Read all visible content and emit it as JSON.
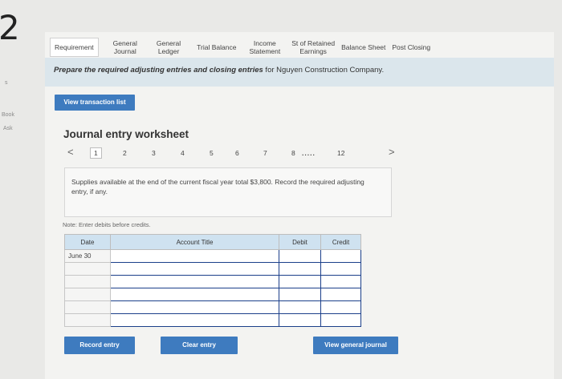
{
  "question_number": "2",
  "side_labels": {
    "mark": "s",
    "book": "Book",
    "ask": "Ask"
  },
  "tabs": [
    {
      "label": "Requirement",
      "active": true
    },
    {
      "label": "General\nJournal",
      "active": false
    },
    {
      "label": "General\nLedger",
      "active": false
    },
    {
      "label": "Trial Balance",
      "active": false
    },
    {
      "label": "Income\nStatement",
      "active": false
    },
    {
      "label": "St of Retained\nEarnings",
      "active": false
    },
    {
      "label": "Balance Sheet",
      "active": false
    },
    {
      "label": "Post Closing",
      "active": false
    }
  ],
  "prompt": {
    "bold": "Prepare the required adjusting entries and closing entries",
    "rest": " for Nguyen Construction Company."
  },
  "view_transactions_label": "View transaction list",
  "worksheet_title": "Journal entry worksheet",
  "pager": {
    "prev": "<",
    "next": ">",
    "pages": [
      "1",
      "2",
      "3",
      "4",
      "5",
      "6",
      "7",
      "8"
    ],
    "ellipsis": ".....",
    "last": "12",
    "current": "1"
  },
  "description": "Supplies available at the end of the current fiscal year total $3,800. Record the required adjusting entry, if any.",
  "note": "Note: Enter debits before credits.",
  "table": {
    "headers": [
      "Date",
      "Account Title",
      "Debit",
      "Credit"
    ],
    "rows": [
      {
        "date": "June 30",
        "account": "",
        "debit": "",
        "credit": ""
      },
      {
        "date": "",
        "account": "",
        "debit": "",
        "credit": ""
      },
      {
        "date": "",
        "account": "",
        "debit": "",
        "credit": ""
      },
      {
        "date": "",
        "account": "",
        "debit": "",
        "credit": ""
      },
      {
        "date": "",
        "account": "",
        "debit": "",
        "credit": ""
      },
      {
        "date": "",
        "account": "",
        "debit": "",
        "credit": ""
      }
    ]
  },
  "buttons": {
    "record": "Record entry",
    "clear": "Clear entry",
    "view_journal": "View general journal"
  },
  "colors": {
    "accent": "#3e7bbf",
    "header_bg": "#cfe2f0",
    "input_border": "#1b3f8a"
  }
}
